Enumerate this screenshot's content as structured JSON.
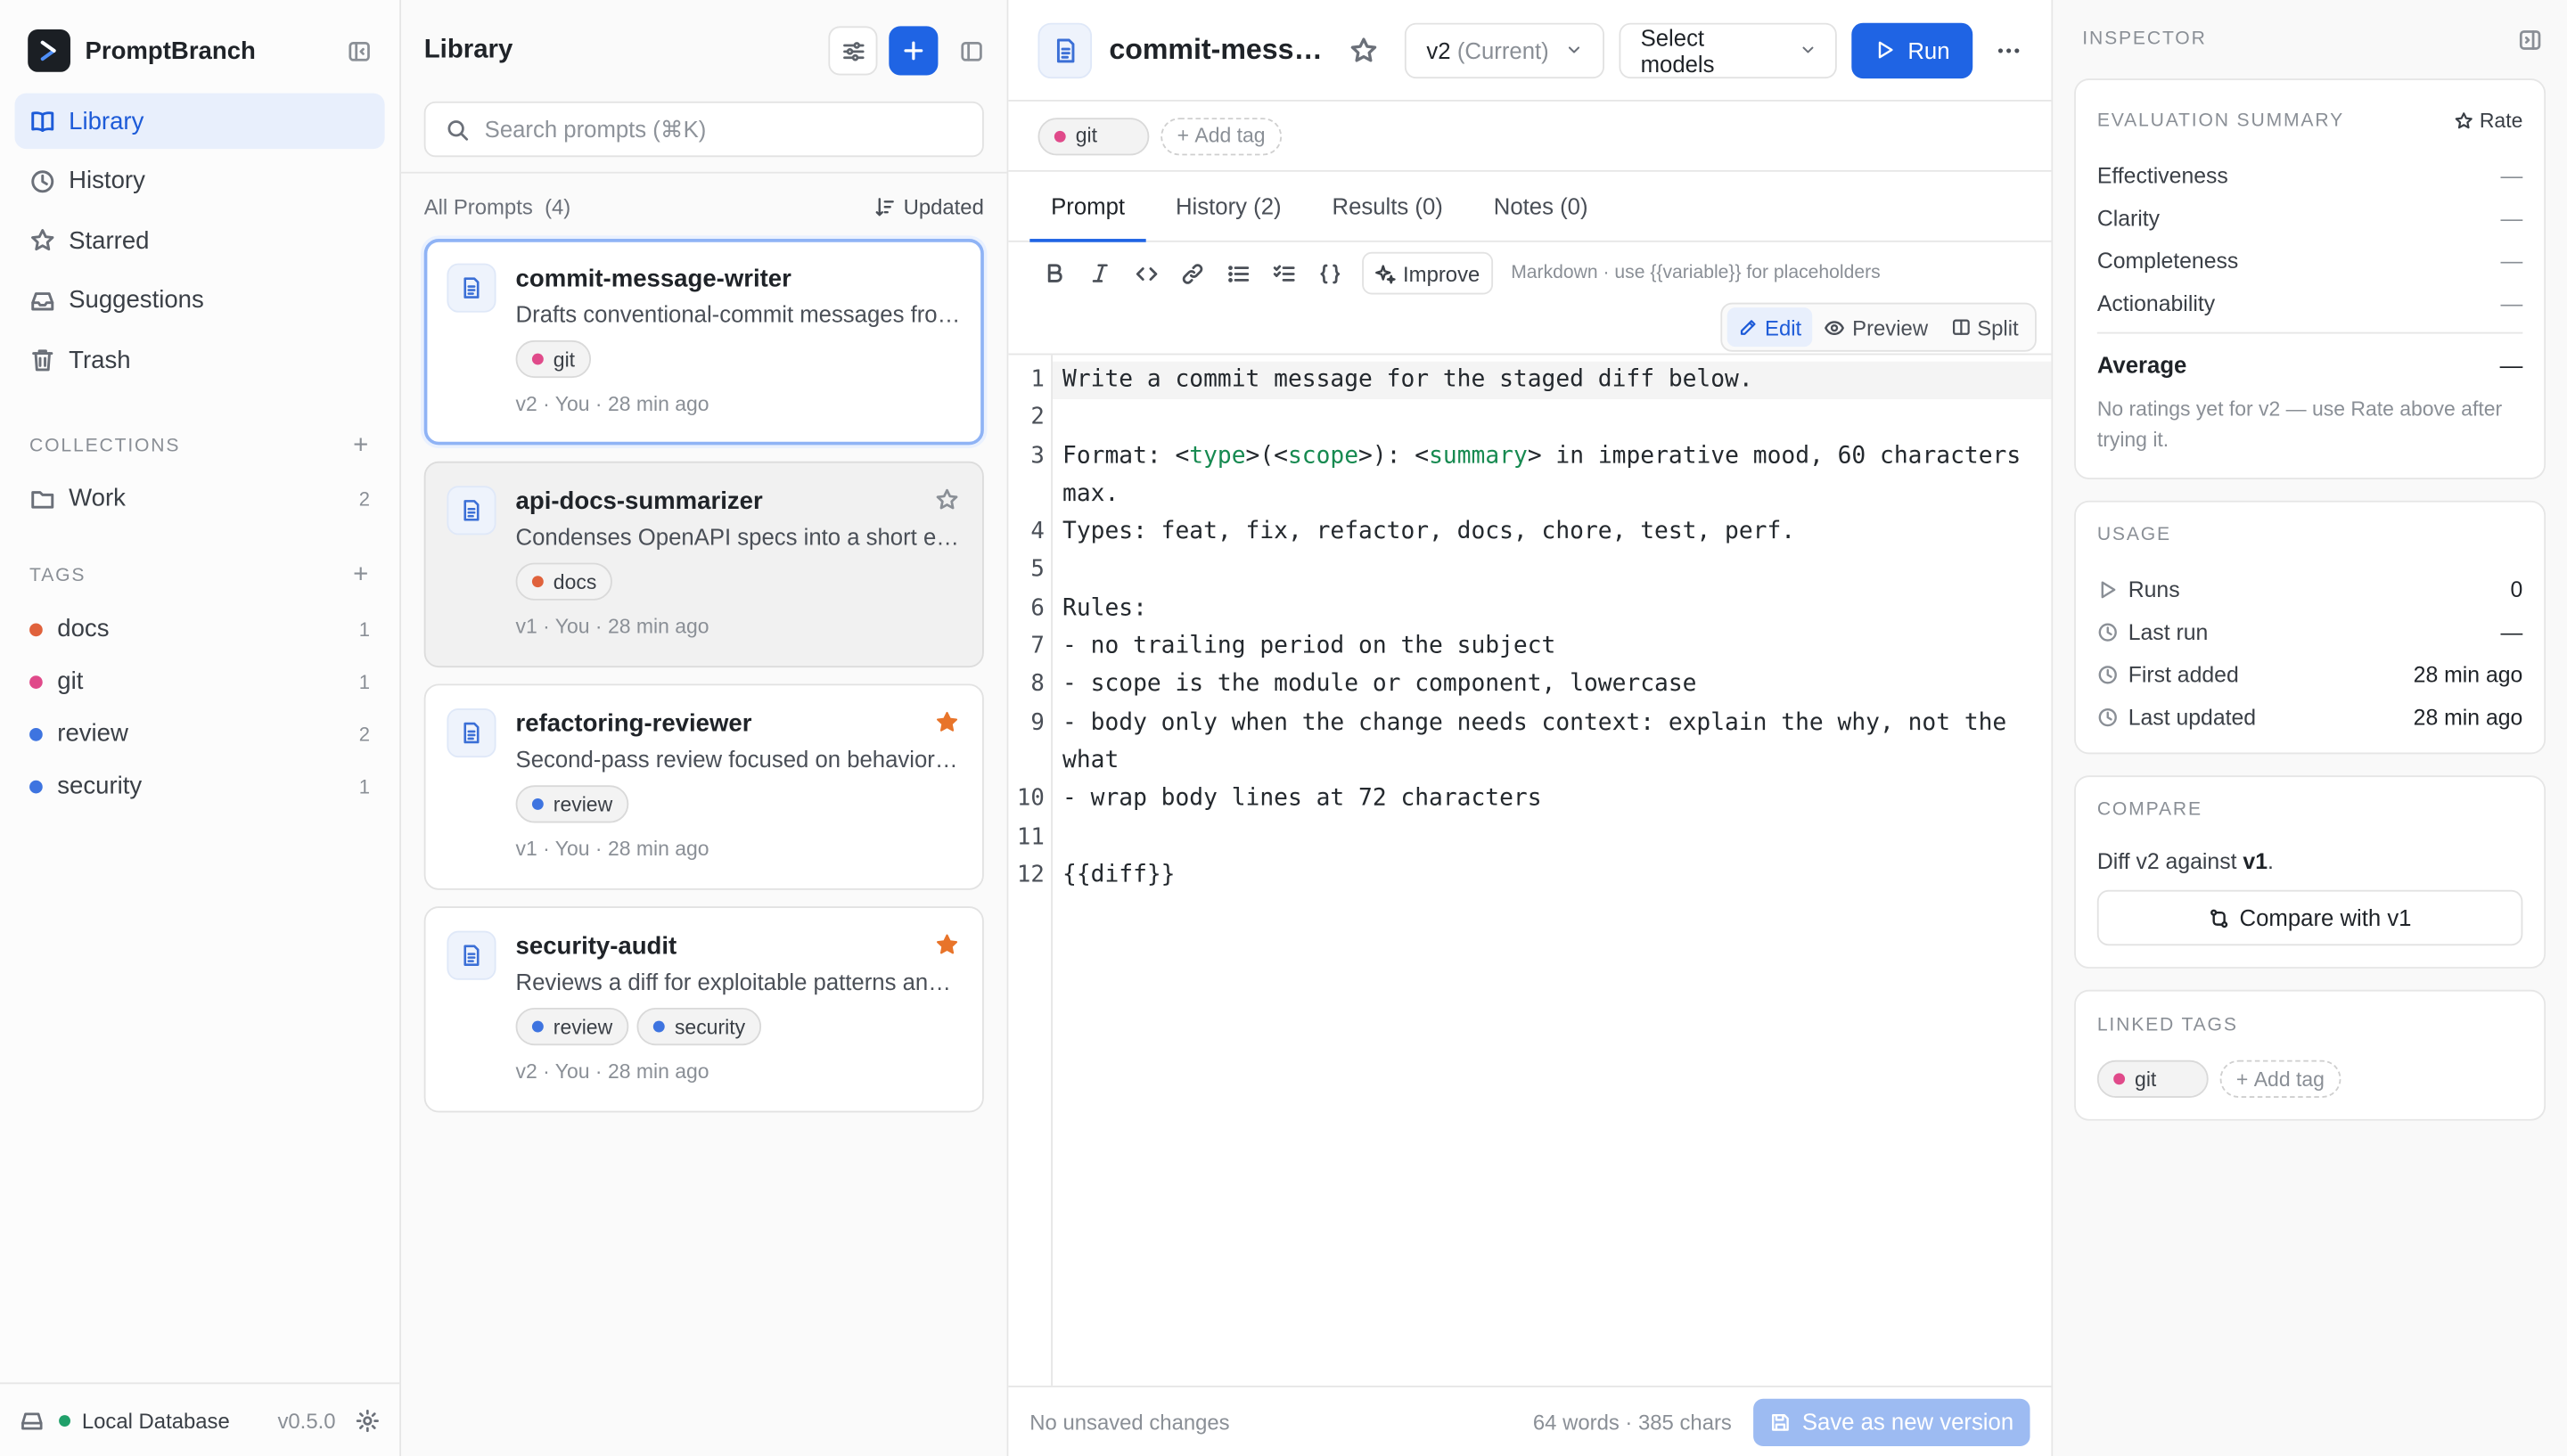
{
  "app": {
    "name": "PromptBranch",
    "version": "v0.5.0"
  },
  "sidebar": {
    "nav": [
      {
        "label": "Library",
        "icon": "book-icon"
      },
      {
        "label": "History",
        "icon": "clock-icon"
      },
      {
        "label": "Starred",
        "icon": "star-icon"
      },
      {
        "label": "Suggestions",
        "icon": "inbox-icon"
      },
      {
        "label": "Trash",
        "icon": "trash-icon"
      }
    ],
    "collections_heading": "COLLECTIONS",
    "collections": [
      {
        "label": "Work",
        "count": "2"
      }
    ],
    "tags_heading": "TAGS",
    "tags": [
      {
        "label": "docs",
        "count": "1",
        "color": "#e0623c"
      },
      {
        "label": "git",
        "count": "1",
        "color": "#e04a8a"
      },
      {
        "label": "review",
        "count": "2",
        "color": "#3e74e0"
      },
      {
        "label": "security",
        "count": "1",
        "color": "#3e74e0"
      }
    ],
    "footer": {
      "db_label": "Local Database",
      "status_color": "#20a06a"
    }
  },
  "library": {
    "title": "Library",
    "search_placeholder": "Search prompts (⌘K)",
    "list_label": "All Prompts",
    "list_count": "(4)",
    "sort_label": "Updated",
    "cards": [
      {
        "title": "commit-message-writer",
        "desc": "Drafts conventional-commit messages from a staged diff.",
        "tags": [
          "git"
        ],
        "meta": "v2 · You · 28 min ago",
        "starred": false
      },
      {
        "title": "api-docs-summarizer",
        "desc": "Condenses OpenAPI specs into a short endpoint overview.",
        "tags": [
          "docs"
        ],
        "meta": "v1 · You · 28 min ago",
        "starred": false
      },
      {
        "title": "refactoring-reviewer",
        "desc": "Second-pass review focused on behavior changes.",
        "tags": [
          "review"
        ],
        "meta": "v1 · You · 28 min ago",
        "starred": true
      },
      {
        "title": "security-audit",
        "desc": "Reviews a diff for exploitable patterns and risky code.",
        "tags": [
          "review",
          "security"
        ],
        "meta": "v2 · You · 28 min ago",
        "starred": true
      }
    ]
  },
  "editor": {
    "title": "commit-message-writer",
    "version_label": "v2",
    "version_suffix": "(Current)",
    "models_label": "Select models",
    "run_label": "Run",
    "tags": [
      "git"
    ],
    "add_tag_label": "Add tag",
    "tabs": [
      "Prompt",
      "History (2)",
      "Results (0)",
      "Notes (0)"
    ],
    "improve_label": "Improve",
    "hint": "Markdown · use {{variable}} for placeholders",
    "modes": [
      "Edit",
      "Preview",
      "Split"
    ],
    "line_numbers": [
      "1",
      "2",
      "3",
      "",
      "4",
      "5",
      "6",
      "7",
      "8",
      "9",
      "",
      "10",
      "11",
      "12"
    ],
    "footer_status": "No unsaved changes",
    "footer_stats": "64 words · 385 chars",
    "save_label": "Save as new version"
  },
  "inspector": {
    "title": "INSPECTOR",
    "eval": {
      "title": "EVALUATION SUMMARY",
      "rate_label": "Rate",
      "metrics": [
        {
          "label": "Effectiveness",
          "value": "—"
        },
        {
          "label": "Clarity",
          "value": "—"
        },
        {
          "label": "Completeness",
          "value": "—"
        },
        {
          "label": "Actionability",
          "value": "—"
        }
      ],
      "average_label": "Average",
      "average_value": "—",
      "note": "No ratings yet for v2 — use Rate above after trying it."
    },
    "usage": {
      "title": "USAGE",
      "rows": [
        {
          "label": "Runs",
          "value": "0"
        },
        {
          "label": "Last run",
          "value": "—"
        },
        {
          "label": "First added",
          "value": "28 min ago"
        },
        {
          "label": "Last updated",
          "value": "28 min ago"
        }
      ]
    },
    "compare": {
      "title": "COMPARE",
      "text_prefix": "Diff v2 against",
      "target": "v1",
      "button_label": "Compare with v1"
    },
    "linked_tags": {
      "title": "LINKED TAGS",
      "tags": [
        "git"
      ],
      "add_tag_label": "Add tag"
    }
  }
}
